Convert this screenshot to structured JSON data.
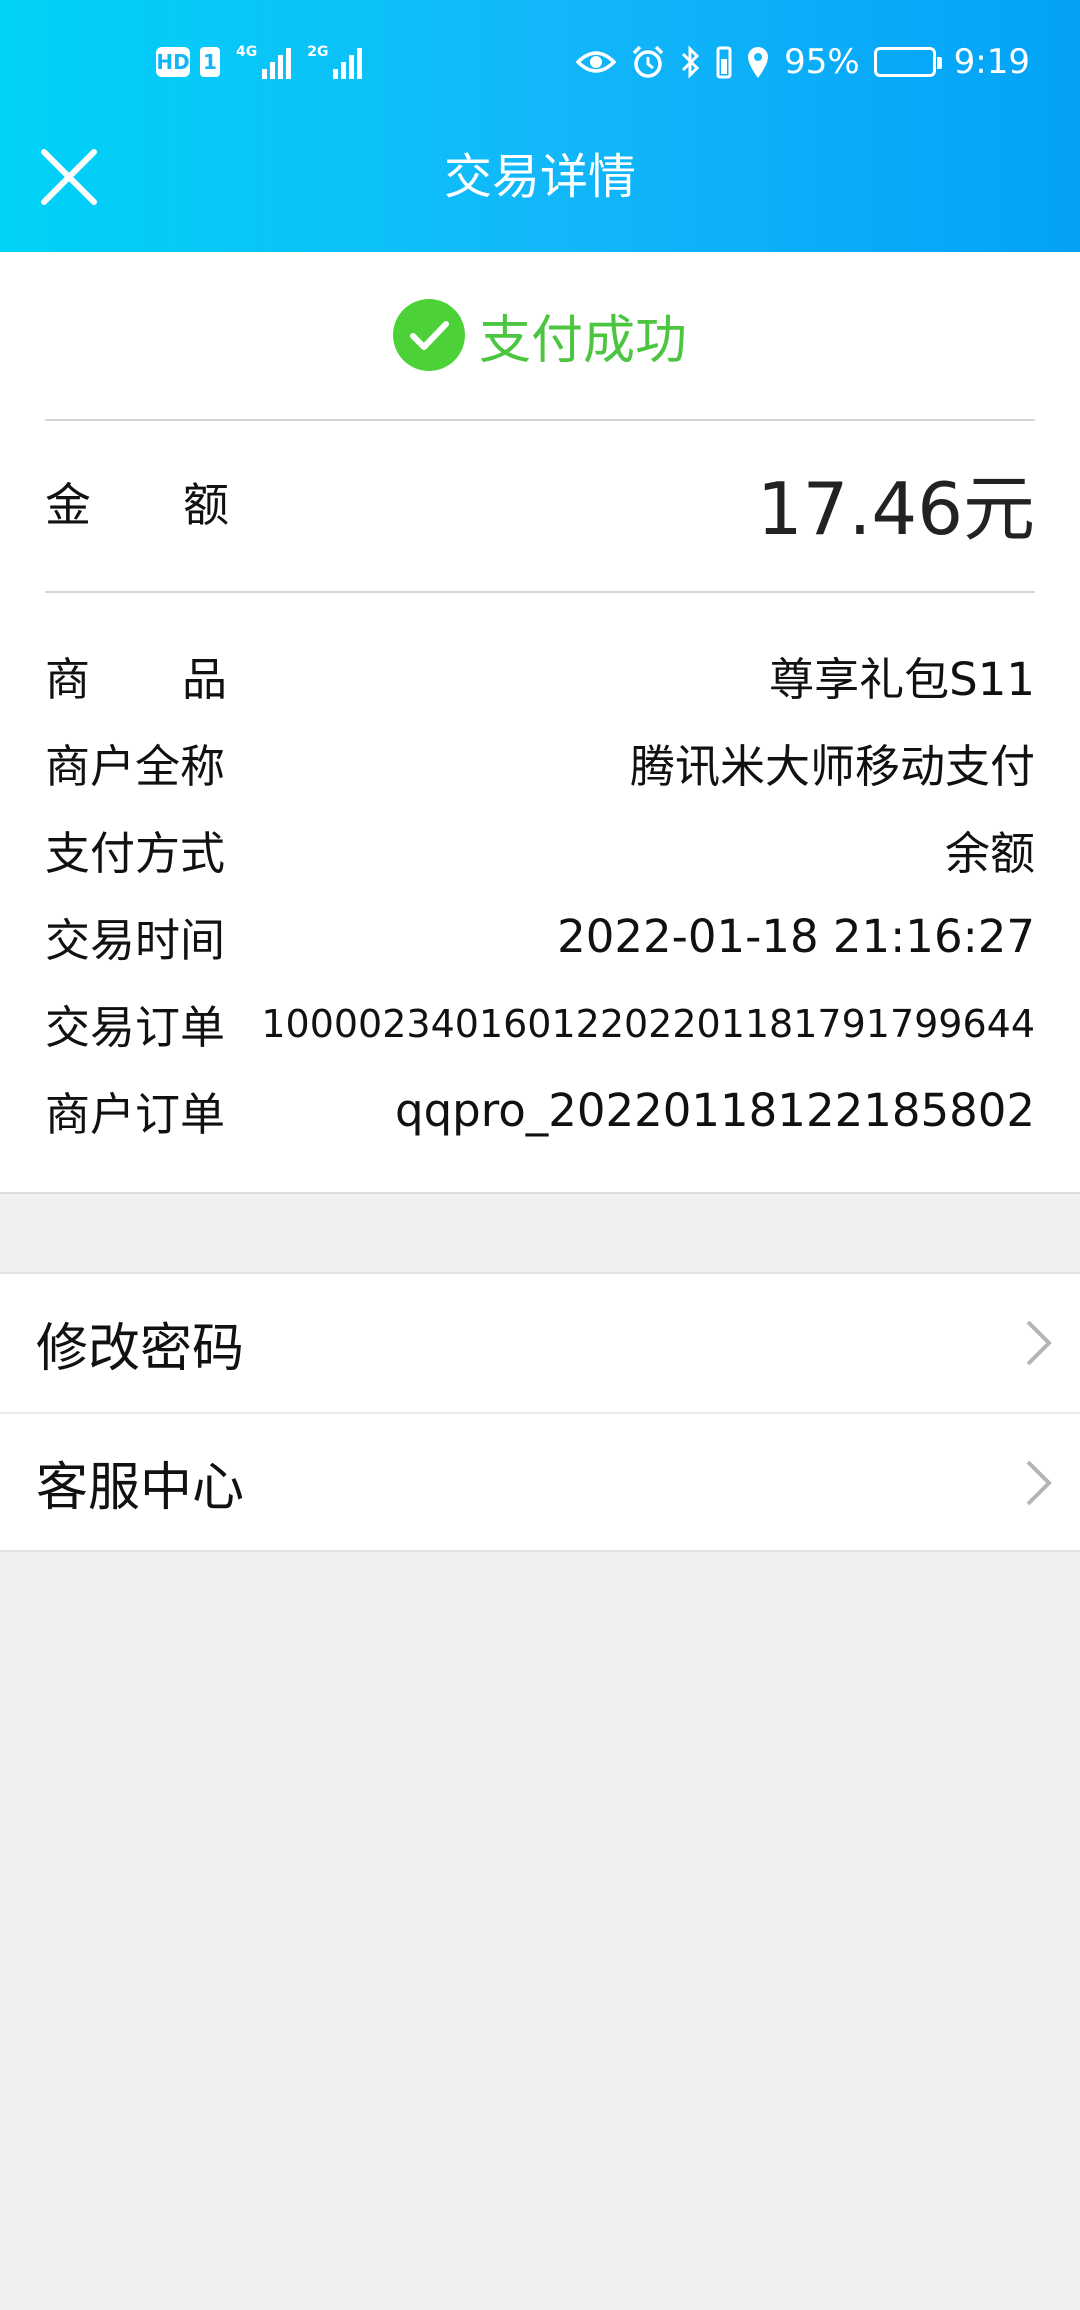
{
  "status_bar": {
    "hd": "HD",
    "sim": "1",
    "net1": "4G",
    "net2": "2G",
    "battery": "95%",
    "time": "9:19"
  },
  "nav": {
    "title": "交易详情",
    "close_icon": "close-icon"
  },
  "status": {
    "text": "支付成功",
    "icon": "check-circle-icon",
    "color": "#4cc641"
  },
  "amount": {
    "label": "金额",
    "value": "17.46元"
  },
  "details": [
    {
      "label": "商品",
      "value": "尊享礼包S11"
    },
    {
      "label": "商户全称",
      "value": "腾讯米大师移动支付"
    },
    {
      "label": "支付方式",
      "value": "余额"
    },
    {
      "label": "交易时间",
      "value": "2022-01-18 21:16:27"
    },
    {
      "label": "交易订单",
      "value": "10000234016012202201181791799644"
    },
    {
      "label": "商户订单",
      "value": "qqpro_20220118122185802"
    }
  ],
  "menu": [
    {
      "label": "修改密码",
      "icon": "chevron-right-icon"
    },
    {
      "label": "客服中心",
      "icon": "chevron-right-icon"
    }
  ]
}
